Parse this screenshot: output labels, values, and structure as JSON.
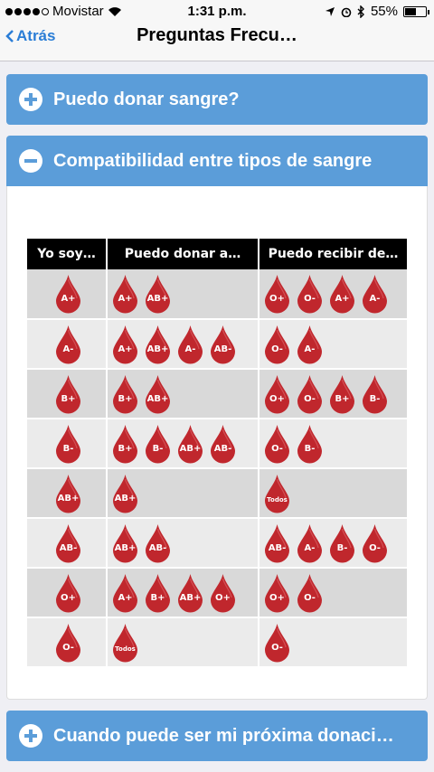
{
  "status": {
    "carrier": "Movistar",
    "time": "1:31 p.m.",
    "battery": "55%"
  },
  "nav": {
    "back": "Atrás",
    "title": "Preguntas Frecu…"
  },
  "sections": [
    {
      "label": "Puedo donar sangre?",
      "expanded": false
    },
    {
      "label": "Compatibilidad entre tipos de sangre",
      "expanded": true
    },
    {
      "label": "Cuando puede ser mi próxima donaci…",
      "expanded": false
    }
  ],
  "table": {
    "headers": [
      "Yo soy…",
      "Puedo donar a…",
      "Puedo recibir de…"
    ],
    "rows": [
      {
        "type": "A+",
        "donate": [
          "A+",
          "AB+"
        ],
        "receive": [
          "O+",
          "O-",
          "A+",
          "A-"
        ]
      },
      {
        "type": "A-",
        "donate": [
          "A+",
          "AB+",
          "A-",
          "AB-"
        ],
        "receive": [
          "O-",
          "A-"
        ]
      },
      {
        "type": "B+",
        "donate": [
          "B+",
          "AB+"
        ],
        "receive": [
          "O+",
          "O-",
          "B+",
          "B-"
        ]
      },
      {
        "type": "B-",
        "donate": [
          "B+",
          "B-",
          "AB+",
          "AB-"
        ],
        "receive": [
          "O-",
          "B-"
        ]
      },
      {
        "type": "AB+",
        "donate": [
          "AB+"
        ],
        "receive": [
          "Todos"
        ]
      },
      {
        "type": "AB-",
        "donate": [
          "AB+",
          "AB-"
        ],
        "receive": [
          "AB-",
          "A-",
          "B-",
          "O-"
        ]
      },
      {
        "type": "O+",
        "donate": [
          "A+",
          "B+",
          "AB+",
          "O+"
        ],
        "receive": [
          "O+",
          "O-"
        ]
      },
      {
        "type": "O-",
        "donate": [
          "Todos"
        ],
        "receive": [
          "O-"
        ]
      }
    ]
  },
  "colors": {
    "accent": "#5b9dd9",
    "link": "#2a7dd6",
    "drop": "#c0272d"
  },
  "icons": {
    "plus": "plus-circle-icon",
    "minus": "minus-circle-icon",
    "drop": "blood-drop-icon"
  }
}
